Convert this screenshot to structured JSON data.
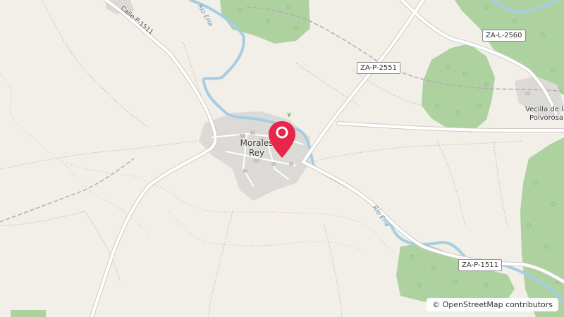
{
  "map": {
    "place_labels": [
      {
        "id": "morales",
        "text": "Morales\nRey"
      },
      {
        "id": "vecilla",
        "text": "Vecilla de la\nPolvorosa"
      }
    ],
    "road_labels": [
      {
        "id": "za-p-1511-top",
        "text": "Calle-P-1511"
      },
      {
        "id": "za-p-2551",
        "text": "ZA-P-2551"
      },
      {
        "id": "za-l-2560",
        "text": "ZA-L-2560"
      },
      {
        "id": "za-p-1511-bottom",
        "text": "ZA-P-1511"
      }
    ],
    "river_labels": [
      {
        "id": "rio-eria-top",
        "text": "Río Eria"
      },
      {
        "id": "rio-eria-mid",
        "text": "Río Eria"
      }
    ],
    "marker": {
      "icon": "location-pin-icon",
      "color": "#e8264b"
    },
    "attribution": "© OpenStreetMap contributors"
  },
  "colors": {
    "background": "#f2efe9",
    "forest": "#aed1a0",
    "water": "#a7cde2",
    "road": "#ffffff",
    "settlement": "#d9d9d9"
  }
}
